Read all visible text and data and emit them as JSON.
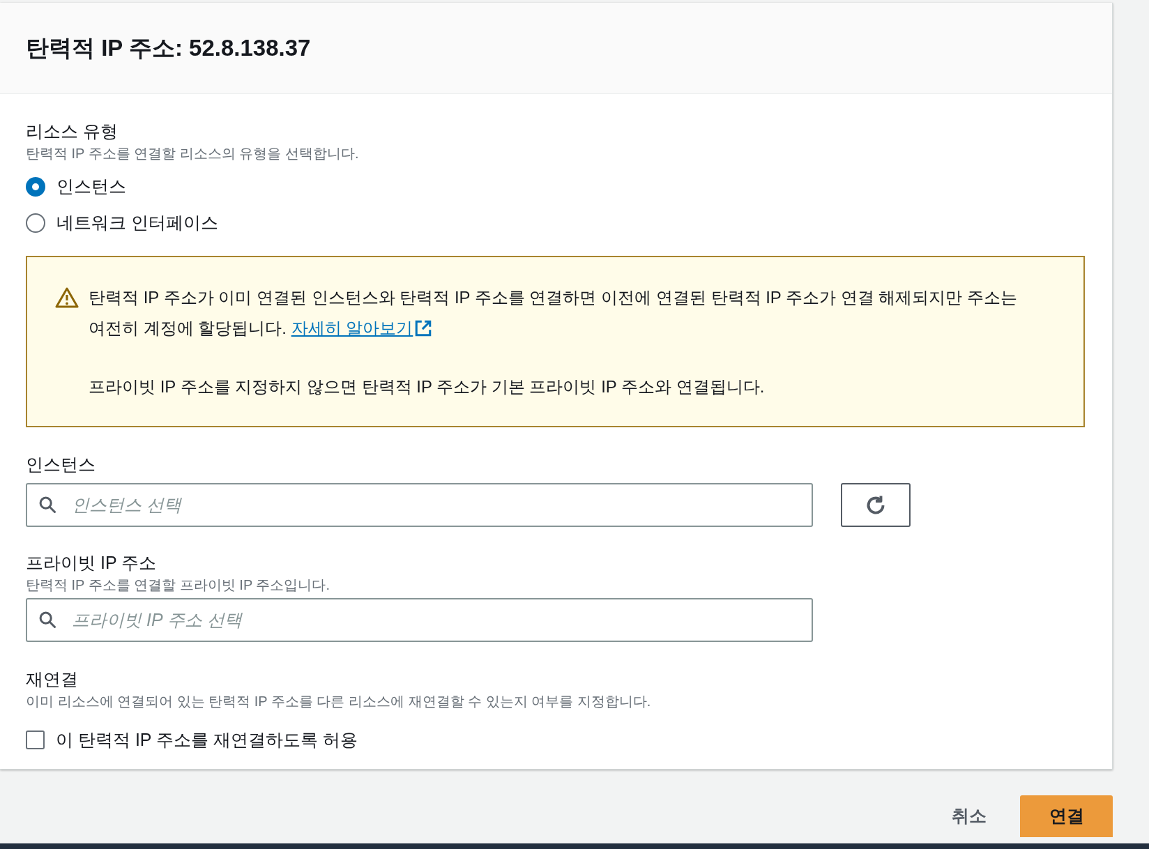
{
  "dialog": {
    "title": "탄력적 IP 주소: 52.8.138.37"
  },
  "resource_type": {
    "label": "리소스 유형",
    "description": "탄력적 IP 주소를 연결할 리소스의 유형을 선택합니다.",
    "options": [
      {
        "label": "인스턴스",
        "selected": true
      },
      {
        "label": "네트워크 인터페이스",
        "selected": false
      }
    ]
  },
  "alert": {
    "kind": "warning",
    "message": "탄력적 IP 주소가 이미 연결된 인스턴스와 탄력적 IP 주소를 연결하면 이전에 연결된 탄력적 IP 주소가 연결 해제되지만 주소는 여전히 계정에 할당됩니다.",
    "link": "자세히 알아보기",
    "note": "프라이빗 IP 주소를 지정하지 않으면 탄력적 IP 주소가 기본 프라이빗 IP 주소와 연결됩니다."
  },
  "instance": {
    "label": "인스턴스",
    "placeholder": "인스턴스 선택"
  },
  "private_ip": {
    "label": "프라이빗 IP 주소",
    "description": "탄력적 IP 주소를 연결할 프라이빗 IP 주소입니다.",
    "placeholder": "프라이빗 IP 주소 선택"
  },
  "reassociation": {
    "label": "재연결",
    "description": "이미 리소스에 연결되어 있는 탄력적 IP 주소를 다른 리소스에 재연결할 수 있는지 여부를 지정합니다.",
    "checkbox_label": "이 탄력적 IP 주소를 재연결하도록 허용",
    "checked": false
  },
  "buttons": [
    {
      "label": "취소",
      "kind": "link"
    },
    {
      "label": "연결",
      "kind": "primary"
    }
  ]
}
